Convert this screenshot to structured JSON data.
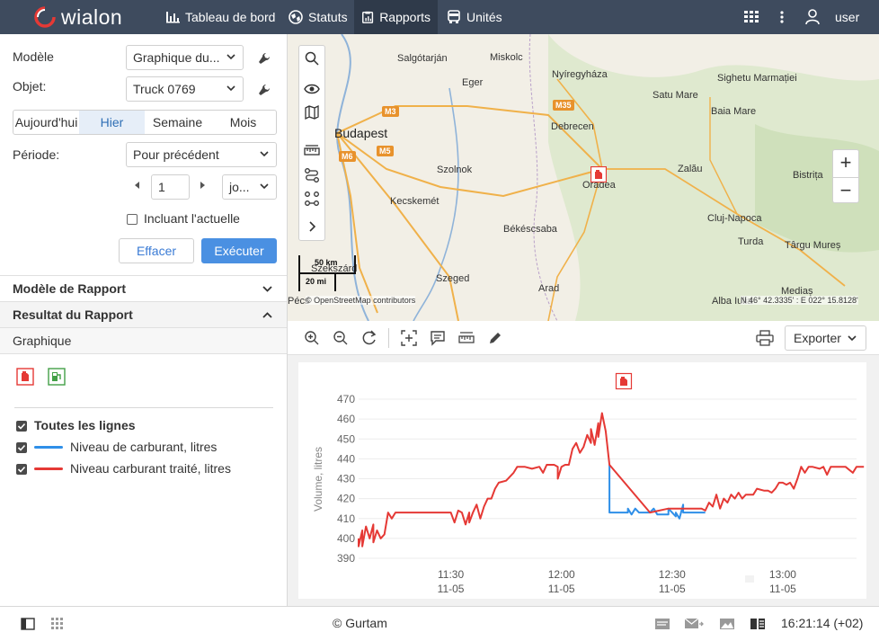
{
  "app": {
    "logo_text": "wialon"
  },
  "nav": {
    "tabs": [
      {
        "label": "Tableau de bord"
      },
      {
        "label": "Statuts"
      },
      {
        "label": "Rapports"
      },
      {
        "label": "Unités"
      }
    ],
    "user_label": "user"
  },
  "left": {
    "modele_label": "Modèle",
    "modele_value": "Graphique du...",
    "objet_label": "Objet:",
    "objet_value": "Truck 0769",
    "quick_periods": [
      "Aujourd'hui",
      "Hier",
      "Semaine",
      "Mois"
    ],
    "selected_quick_period": "Hier",
    "periode_label": "Période:",
    "periode_value": "Pour précédent",
    "count_value": "1",
    "unit_value": "jo...",
    "include_current_label": "Incluant l'actuelle",
    "include_current_checked": false,
    "clear_label": "Effacer",
    "execute_label": "Exécuter",
    "modele_rapport_label": "Modèle de Rapport",
    "resultat_label": "Resultat du Rapport",
    "graphique_label": "Graphique",
    "legend": {
      "all_label": "Toutes les lignes",
      "items": [
        {
          "label": "Niveau de carburant, litres",
          "color": "#2f8fe8",
          "checked": true
        },
        {
          "label": "Niveau carburant traité, litres",
          "color": "#e53935",
          "checked": true
        }
      ]
    }
  },
  "map": {
    "cities": [
      "Salgótarján",
      "Miskolc",
      "Nyíregyháza",
      "Satu Mare",
      "Sighetu Marmației",
      "Eger",
      "Baia Mare",
      "Budapest",
      "Debrecen",
      "Szolnok",
      "Oradea",
      "Zalău",
      "Bistrița",
      "Kecskemét",
      "Cluj-Napoca",
      "Békéscsaba",
      "Turda",
      "Târgu Mureș",
      "Szekszárd",
      "Szeged",
      "Arad",
      "Mediaș",
      "Alba Iulia",
      "Pécs"
    ],
    "road_badges": [
      "M3",
      "M35",
      "M6",
      "M5"
    ],
    "scale_km": "50 km",
    "scale_mi": "20 mi",
    "attribution": "© OpenStreetMap contributors",
    "coords": "N 46° 42.3335' : E 022° 15.8128'"
  },
  "chart_toolbar": {
    "export_label": "Exporter"
  },
  "chart_data": {
    "type": "line",
    "ylabel": "Volume, litres",
    "ylim": [
      390,
      470
    ],
    "yticks": [
      390,
      400,
      410,
      420,
      430,
      440,
      450,
      460,
      470
    ],
    "xticks": [
      {
        "t": "11:30",
        "d": "11-05"
      },
      {
        "t": "12:00",
        "d": "11-05"
      },
      {
        "t": "12:30",
        "d": "11-05"
      },
      {
        "t": "13:00",
        "d": "11-05"
      }
    ],
    "x_range": [
      "11:05",
      "13:20"
    ],
    "series": [
      {
        "name": "Niveau de carburant, litres",
        "color": "#2f8fe8",
        "points": [
          [
            "12:13",
            437
          ],
          [
            "12:13",
            413
          ],
          [
            "12:18",
            413
          ],
          [
            "12:18",
            415
          ],
          [
            "12:19",
            412
          ],
          [
            "12:20",
            415
          ],
          [
            "12:21",
            413
          ],
          [
            "12:24",
            413
          ],
          [
            "12:25",
            415
          ],
          [
            "12:26",
            412
          ],
          [
            "12:29",
            412
          ],
          [
            "12:29",
            415
          ],
          [
            "12:30",
            413
          ],
          [
            "12:31",
            411
          ],
          [
            "12:31",
            413
          ],
          [
            "12:32",
            410
          ],
          [
            "12:33",
            417
          ],
          [
            "12:33",
            413
          ],
          [
            "12:39",
            413
          ]
        ]
      },
      {
        "name": "Niveau carburant traité, litres",
        "color": "#e53935",
        "points": [
          [
            "11:05",
            400
          ],
          [
            "11:05",
            396
          ],
          [
            "11:06",
            404
          ],
          [
            "11:06",
            396
          ],
          [
            "11:07",
            406
          ],
          [
            "11:08",
            400
          ],
          [
            "11:09",
            407
          ],
          [
            "11:09",
            398
          ],
          [
            "11:10",
            404
          ],
          [
            "11:11",
            400
          ],
          [
            "11:12",
            402
          ],
          [
            "11:13",
            413
          ],
          [
            "11:14",
            410
          ],
          [
            "11:15",
            413
          ],
          [
            "11:16",
            413
          ],
          [
            "11:22",
            413
          ],
          [
            "11:25",
            413
          ],
          [
            "11:30",
            413
          ],
          [
            "11:31",
            408
          ],
          [
            "11:32",
            414
          ],
          [
            "11:33",
            413
          ],
          [
            "11:34",
            407
          ],
          [
            "11:35",
            413
          ],
          [
            "11:35",
            408
          ],
          [
            "11:36",
            413
          ],
          [
            "11:37",
            417
          ],
          [
            "11:38",
            410
          ],
          [
            "11:39",
            416
          ],
          [
            "11:40",
            420
          ],
          [
            "11:41",
            420
          ],
          [
            "11:42",
            425
          ],
          [
            "11:43",
            428
          ],
          [
            "11:45",
            429
          ],
          [
            "11:47",
            433
          ],
          [
            "11:48",
            436
          ],
          [
            "11:50",
            436
          ],
          [
            "11:52",
            435
          ],
          [
            "11:54",
            436
          ],
          [
            "11:55",
            433
          ],
          [
            "11:56",
            437
          ],
          [
            "11:58",
            437
          ],
          [
            "11:59",
            436
          ],
          [
            "11:59",
            430
          ],
          [
            "12:00",
            436
          ],
          [
            "12:01",
            437
          ],
          [
            "12:02",
            437
          ],
          [
            "12:03",
            445
          ],
          [
            "12:04",
            448
          ],
          [
            "12:05",
            443
          ],
          [
            "12:06",
            446
          ],
          [
            "12:07",
            452
          ],
          [
            "12:08",
            448
          ],
          [
            "12:08",
            455
          ],
          [
            "12:09",
            447
          ],
          [
            "12:10",
            458
          ],
          [
            "12:10",
            451
          ],
          [
            "12:11",
            463
          ],
          [
            "12:12",
            454
          ],
          [
            "12:13",
            437
          ],
          [
            "12:24",
            413
          ],
          [
            "12:29",
            415
          ],
          [
            "12:33",
            415
          ],
          [
            "12:38",
            415
          ],
          [
            "12:39",
            414
          ],
          [
            "12:40",
            418
          ],
          [
            "12:41",
            416
          ],
          [
            "12:42",
            422
          ],
          [
            "12:43",
            415
          ],
          [
            "12:44",
            420
          ],
          [
            "12:45",
            418
          ],
          [
            "12:46",
            422
          ],
          [
            "12:47",
            420
          ],
          [
            "12:48",
            423
          ],
          [
            "12:49",
            420
          ],
          [
            "12:50",
            422
          ],
          [
            "12:52",
            422
          ],
          [
            "12:53",
            425
          ],
          [
            "12:55",
            424
          ],
          [
            "12:56",
            424
          ],
          [
            "12:57",
            423
          ],
          [
            "12:58",
            425
          ],
          [
            "12:59",
            428
          ],
          [
            "13:00",
            428
          ],
          [
            "13:01",
            427
          ],
          [
            "13:02",
            428
          ],
          [
            "13:03",
            425
          ],
          [
            "13:04",
            430
          ],
          [
            "13:05",
            436
          ],
          [
            "13:06",
            433
          ],
          [
            "13:07",
            436
          ],
          [
            "13:08",
            436
          ],
          [
            "13:10",
            435
          ],
          [
            "13:11",
            436
          ],
          [
            "13:12",
            432
          ],
          [
            "13:13",
            436
          ],
          [
            "13:14",
            436
          ],
          [
            "13:16",
            436
          ],
          [
            "13:17",
            436
          ],
          [
            "13:19",
            433
          ],
          [
            "13:20",
            436
          ],
          [
            "13:22",
            436
          ]
        ]
      }
    ]
  },
  "status": {
    "copyright": "© Gurtam",
    "time": "16:21:14 (+02)"
  }
}
